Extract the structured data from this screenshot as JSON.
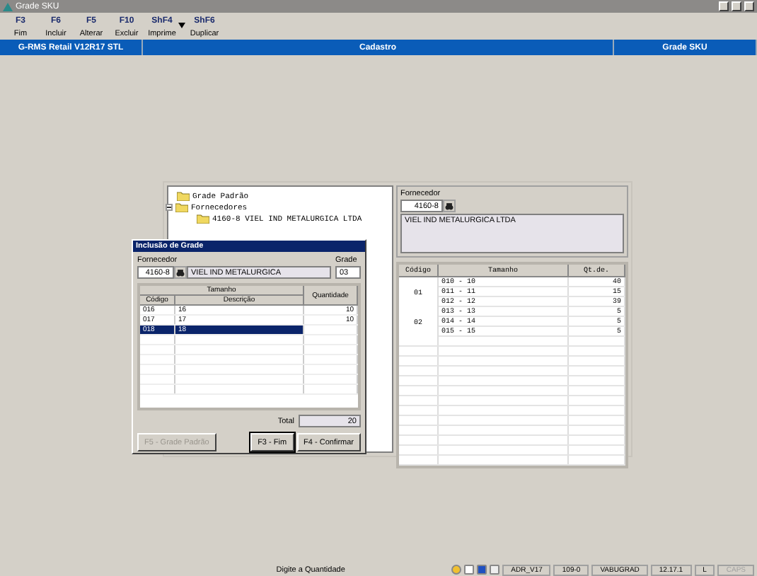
{
  "window": {
    "title": "Grade SKU"
  },
  "toolbar": [
    {
      "key": "F3",
      "label": "Fim",
      "has_menu": false
    },
    {
      "key": "F6",
      "label": "Incluir",
      "has_menu": false
    },
    {
      "key": "F5",
      "label": "Alterar",
      "has_menu": false
    },
    {
      "key": "F10",
      "label": "Excluir",
      "has_menu": false
    },
    {
      "key": "ShF4",
      "label": "Imprime",
      "has_menu": true
    },
    {
      "key": "ShF6",
      "label": "Duplicar",
      "has_menu": false
    }
  ],
  "header_bar": [
    "G-RMS Retail V12R17 STL",
    "Cadastro",
    "Grade SKU"
  ],
  "tree": [
    {
      "label": "Grade Padrão"
    },
    {
      "label": "Fornecedores",
      "expanded": true,
      "children": [
        {
          "label": "4160-8 VIEL IND METALURGICA LTDA"
        }
      ]
    }
  ],
  "supplier_panel": {
    "label": "Fornecedor",
    "code": "4160-8",
    "name": "VIEL IND METALURGICA LTDA"
  },
  "size_grid": {
    "columns": [
      "Código",
      "Tamanho",
      "Qt.de."
    ],
    "groups": [
      {
        "code": "01",
        "rows": [
          {
            "size": "010 - 10",
            "qty": "40"
          },
          {
            "size": "011 - 11",
            "qty": "15"
          },
          {
            "size": "012 - 12",
            "qty": "39"
          }
        ]
      },
      {
        "code": "02",
        "rows": [
          {
            "size": "013 - 13",
            "qty": "5"
          },
          {
            "size": "014 - 14",
            "qty": "5"
          },
          {
            "size": "015 - 15",
            "qty": "5"
          }
        ]
      }
    ]
  },
  "dialog": {
    "title": "Inclusão de Grade",
    "supplier_label": "Fornecedor",
    "supplier_code": "4160-8",
    "supplier_name": "VIEL IND METALURGICA",
    "grade_label": "Grade",
    "grade": "03",
    "group_header": "Tamanho",
    "columns": [
      "Código",
      "Descrição",
      "Quantidade"
    ],
    "rows": [
      {
        "code": "016",
        "description": "16",
        "quantity": "10",
        "selected": false
      },
      {
        "code": "017",
        "description": "17",
        "quantity": "10",
        "selected": false
      },
      {
        "code": "018",
        "description": "18",
        "quantity": "",
        "selected": true
      }
    ],
    "total_label": "Total",
    "total": "20",
    "buttons": [
      {
        "label": "F5 - Grade Padrão",
        "disabled": true,
        "default": false
      },
      {
        "label": "F3 - Fim",
        "disabled": false,
        "default": true
      },
      {
        "label": "F4 - Confirmar",
        "disabled": false,
        "default": false
      }
    ]
  },
  "status_bar": {
    "message": "Digite a Quantidade",
    "cells": [
      {
        "text": "ADR_V17",
        "disabled": false
      },
      {
        "text": "109-0",
        "disabled": false
      },
      {
        "text": "VABUGRAD",
        "disabled": false
      },
      {
        "text": "12.17.1",
        "disabled": false
      },
      {
        "text": "L",
        "disabled": false
      },
      {
        "text": "CAPS",
        "disabled": true
      }
    ]
  }
}
